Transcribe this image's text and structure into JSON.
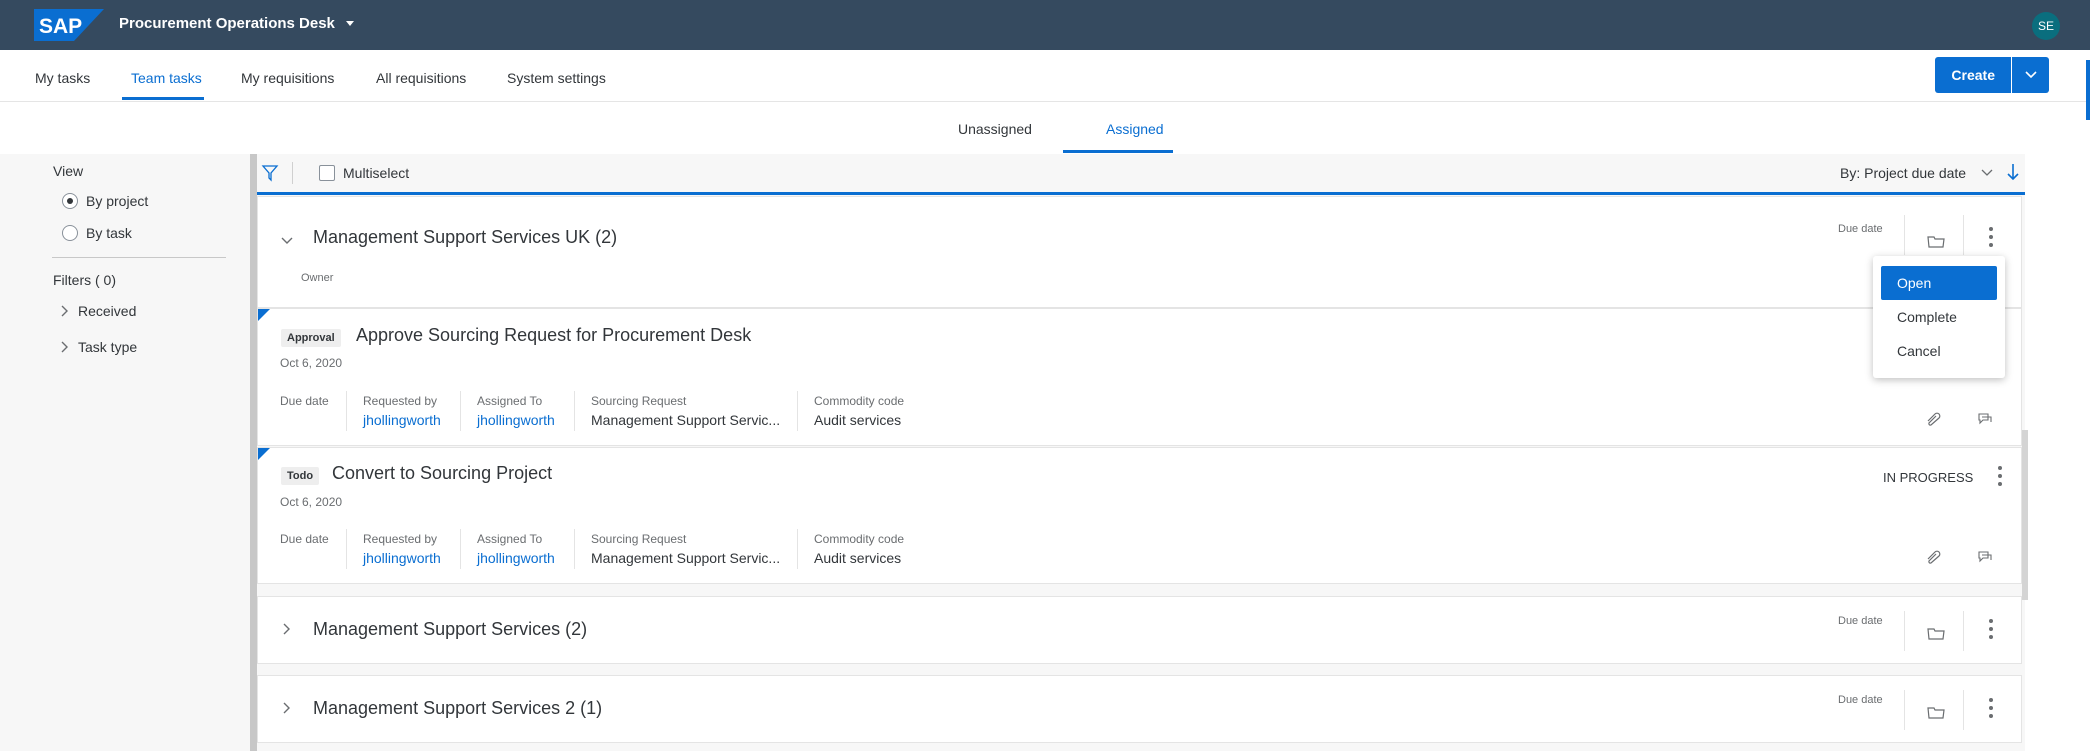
{
  "shell": {
    "brand": "SAP",
    "app_title": "Procurement Operations Desk",
    "avatar": "SE"
  },
  "topnav": {
    "tabs": [
      {
        "label": "My tasks"
      },
      {
        "label": "Team tasks"
      },
      {
        "label": "My requisitions"
      },
      {
        "label": "All requisitions"
      },
      {
        "label": "System settings"
      }
    ],
    "active_tab": "Team tasks",
    "create_label": "Create"
  },
  "subnav": {
    "tabs": [
      {
        "label": "Unassigned"
      },
      {
        "label": "Assigned"
      }
    ],
    "active_tab": "Assigned"
  },
  "leftpanel": {
    "view_label": "View",
    "view_options": [
      {
        "label": "By project",
        "selected": true
      },
      {
        "label": "By task",
        "selected": false
      }
    ],
    "filters_label": "Filters ( 0)",
    "filter_items": [
      {
        "label": "Received"
      },
      {
        "label": "Task type"
      }
    ]
  },
  "toolbar": {
    "multiselect_label": "Multiselect",
    "sort_label": "By: Project due date"
  },
  "groups": [
    {
      "title": "Management Support Services UK (2)",
      "owner_label": "Owner",
      "due_label": "Due date",
      "expanded": true,
      "tasks": [
        {
          "badge": "Approval",
          "title": "Approve Sourcing Request for Procurement Desk",
          "date": "Oct 6, 2020",
          "status": "",
          "fields": {
            "due_label": "Due date",
            "requested_by_label": "Requested by",
            "requested_by": "jhollingworth",
            "assigned_to_label": "Assigned To",
            "assigned_to": "jhollingworth",
            "sourcing_request_label": "Sourcing Request",
            "sourcing_request": "Management Support Servic...",
            "commodity_code_label": "Commodity code",
            "commodity_code": "Audit services"
          }
        },
        {
          "badge": "Todo",
          "title": "Convert to Sourcing Project",
          "date": "Oct 6, 2020",
          "status": "IN PROGRESS",
          "fields": {
            "due_label": "Due date",
            "requested_by_label": "Requested by",
            "requested_by": "jhollingworth",
            "assigned_to_label": "Assigned To",
            "assigned_to": "jhollingworth",
            "sourcing_request_label": "Sourcing Request",
            "sourcing_request": "Management Support Servic...",
            "commodity_code_label": "Commodity code",
            "commodity_code": "Audit services"
          }
        }
      ]
    },
    {
      "title": "Management Support Services (2)",
      "due_label": "Due date",
      "expanded": false
    },
    {
      "title": "Management Support Services 2 (1)",
      "due_label": "Due date",
      "expanded": false
    }
  ],
  "context_menu": {
    "items": [
      {
        "label": "Open"
      },
      {
        "label": "Complete"
      },
      {
        "label": "Cancel"
      }
    ],
    "selected": "Open"
  },
  "colors": {
    "shell_bg": "#354a5f",
    "accent": "#0a6ed1",
    "avatar_bg": "#0a6e7e"
  },
  "icons": [
    "chevron-down-icon",
    "filter-icon",
    "sort-descending-icon",
    "folder-icon",
    "more-vertical-icon",
    "attachment-icon",
    "comment-icon",
    "chevron-right-icon"
  ]
}
